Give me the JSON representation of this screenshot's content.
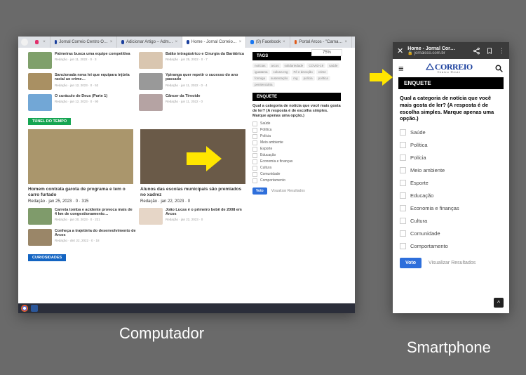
{
  "browser": {
    "tabs": [
      {
        "label": "",
        "favicon": "#e1306c"
      },
      {
        "label": "Jornal Correio Centro O…",
        "favicon": "#1a3f9d"
      },
      {
        "label": "Adicionar Artigo – Adm…",
        "favicon": "#1a3f9d"
      },
      {
        "label": "Home - Jornal Correio…",
        "favicon": "#1a3f9d",
        "active": true
      },
      {
        "label": "(9) Facebook",
        "favicon": "#1877f2"
      },
      {
        "label": "Portal Arcos - \"Carna…",
        "favicon": "#e05a1a"
      }
    ],
    "percent": "75%"
  },
  "content": {
    "row1": [
      {
        "title": "Palmeiras busca uma equipe competitiva",
        "meta": "Redação · jun 11, 2022 · 0 · 3"
      },
      {
        "title": "Balão intragástrico e Cirurgia da Bariátrica",
        "meta": "Redação · jun 25, 2022 · 0 · 7"
      }
    ],
    "row2": [
      {
        "title": "Sancionada nova lei que equipara injúria racial ao crime…",
        "meta": "Redação · jan 12, 2023 · 0 · 52"
      },
      {
        "title": "Ypiranga quer repetir o sucesso do ano passado",
        "meta": "Redação · jun 11, 2022 · 0 · 4"
      }
    ],
    "row3": [
      {
        "title": "O curáculo de Deus (Parte 1)",
        "meta": "Redação · jan 12, 2023 · 0 · 90"
      },
      {
        "title": "Câncer da Tireoide",
        "meta": "Redação · jun 11, 2022 · 0"
      }
    ],
    "tunnel_label": "TÚNEL DO TEMPO",
    "big": [
      {
        "title": "Homem contrata garota de programa e tem o carro furtado",
        "meta": "Redação · jan 25, 2023 · 0 · 315"
      },
      {
        "title": "Alunos das escolas municipais são premiados no xadrez",
        "meta": "Redação · jan 22, 2023 · 0"
      }
    ],
    "row4": [
      {
        "title": "Carreta tomba e acidente provoca mais de 4 km de congestionamento…",
        "meta": "Redação · jan 20, 2023 · 0 · 221"
      },
      {
        "title": "João Lucas é o primeiro bebê de 2008 em Arcos",
        "meta": "Redação · jan 22, 2023 · 0"
      }
    ],
    "row5": [
      {
        "title": "Conheça a trajetória do desenvolvimento de Arcos",
        "meta": "Redação · dez 22, 2022 · 0 · 18"
      }
    ],
    "curiosidades_label": "CURIOSIDADES"
  },
  "sidebar": {
    "tags_label": "TAGS",
    "tags": [
      "notícias",
      "arcos",
      "solidariedade",
      "COVID-19",
      "saúde",
      "iguatama",
      "coluna reg",
      "Fé e devoção",
      "crime",
      "formiga",
      "sustentação",
      "mg",
      "polícia",
      "política",
      "penitenciária"
    ],
    "enquete_label": "ENQUETE"
  },
  "poll": {
    "question": "Qual a categoria de notícia que você mais gosta de ler? (A resposta é de escolha simples. Marque apenas uma opção.)",
    "options": [
      "Saúde",
      "Política",
      "Polícia",
      "Meio ambiente",
      "Esporte",
      "Educação",
      "Economia e finanças",
      "Cultura",
      "Comunidade",
      "Comportamento"
    ],
    "vote": "Voto",
    "results": "Visualizar Resultados"
  },
  "phone": {
    "title": "Home - Jornal Cor…",
    "url": "jornalcco.com.br",
    "logo": "CORREIO",
    "logo_sub": "Centro Oeste"
  },
  "captions": {
    "desktop": "Computador",
    "phone": "Smartphone"
  }
}
